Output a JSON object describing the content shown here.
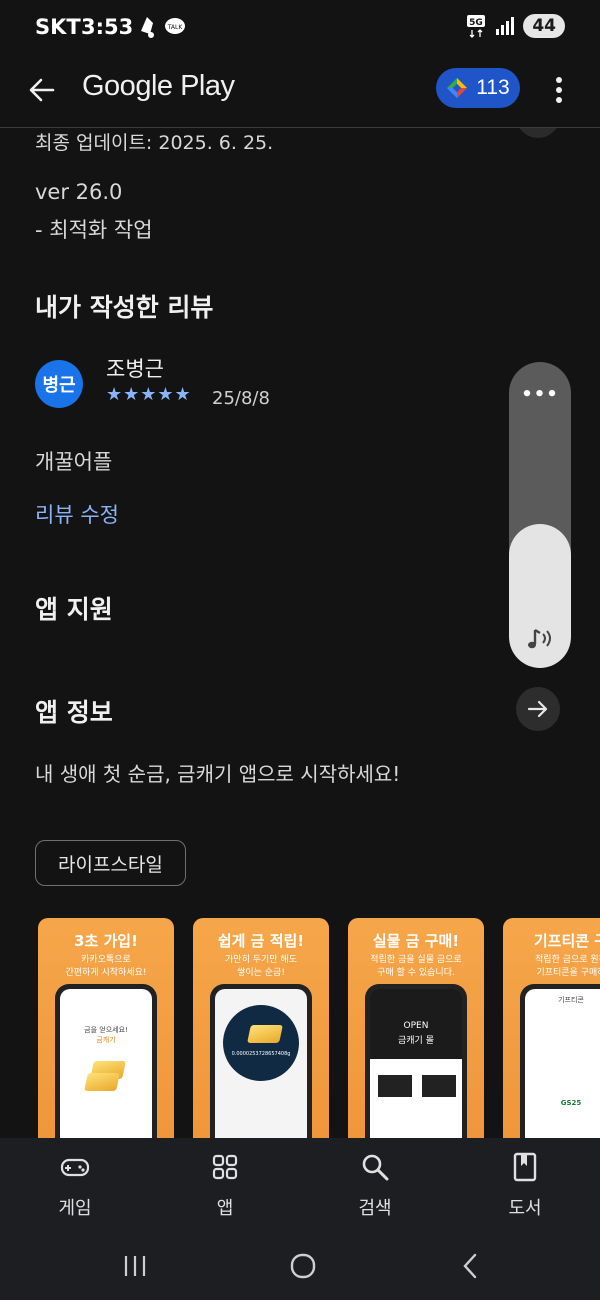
{
  "status_bar": {
    "carrier": "SKT",
    "time": "3:53",
    "network": "5G",
    "battery": "44"
  },
  "app_bar": {
    "title": "Google Play",
    "points": "113"
  },
  "details": {
    "last_update": "최종 업데이트: 2025. 6. 25.",
    "version": "ver 26.0",
    "change_note": "- 최적화 작업"
  },
  "my_review": {
    "section_title": "내가 작성한 리뷰",
    "avatar_text": "병근",
    "reviewer_name": "조병근",
    "stars": "★★★★★",
    "rating": 5,
    "date": "25/8/8",
    "text": "개꿀어플",
    "edit_label": "리뷰 수정"
  },
  "app_support": {
    "title": "앱 지원"
  },
  "app_info": {
    "title": "앱 정보",
    "description": "내 생애 첫 순금, 금캐기 앱으로 시작하세요!",
    "category_chip": "라이프스타일"
  },
  "screenshots": [
    {
      "headline": "3초 가입!",
      "sub1": "카카오톡으로",
      "sub2": "간편하게 시작하세요!",
      "screen1": "금을 얻으세요!",
      "screen2": "금캐기"
    },
    {
      "headline": "쉽게 금 적립!",
      "sub1": "가만히 두기만 해도",
      "sub2": "쌓이는 순금!",
      "screen1": "0.0000253728657408g",
      "screen2": ""
    },
    {
      "headline": "실물 금 구매!",
      "sub1": "적립한 금을 실물 금으로",
      "sub2": "구매 할 수 있습니다.",
      "screen1": "OPEN",
      "screen2": "금캐기 몰"
    },
    {
      "headline": "기프티콘 구",
      "sub1": "적립한 금으로 원하",
      "sub2": "기프티콘을 구매하",
      "screen1": "기프티콘",
      "screen2": "GS25"
    }
  ],
  "volume": {
    "menu": "•••",
    "level": 0.47
  },
  "bottom_nav": {
    "items": [
      {
        "label": "게임",
        "icon": "gamepad-icon"
      },
      {
        "label": "앱",
        "icon": "apps-grid-icon"
      },
      {
        "label": "검색",
        "icon": "search-icon"
      },
      {
        "label": "도서",
        "icon": "book-icon"
      }
    ]
  },
  "colors": {
    "background": "#131313",
    "accent_blue": "#8ab4f8",
    "points_pill": "#1f55c9",
    "screenshot_orange": "#f0953a"
  }
}
